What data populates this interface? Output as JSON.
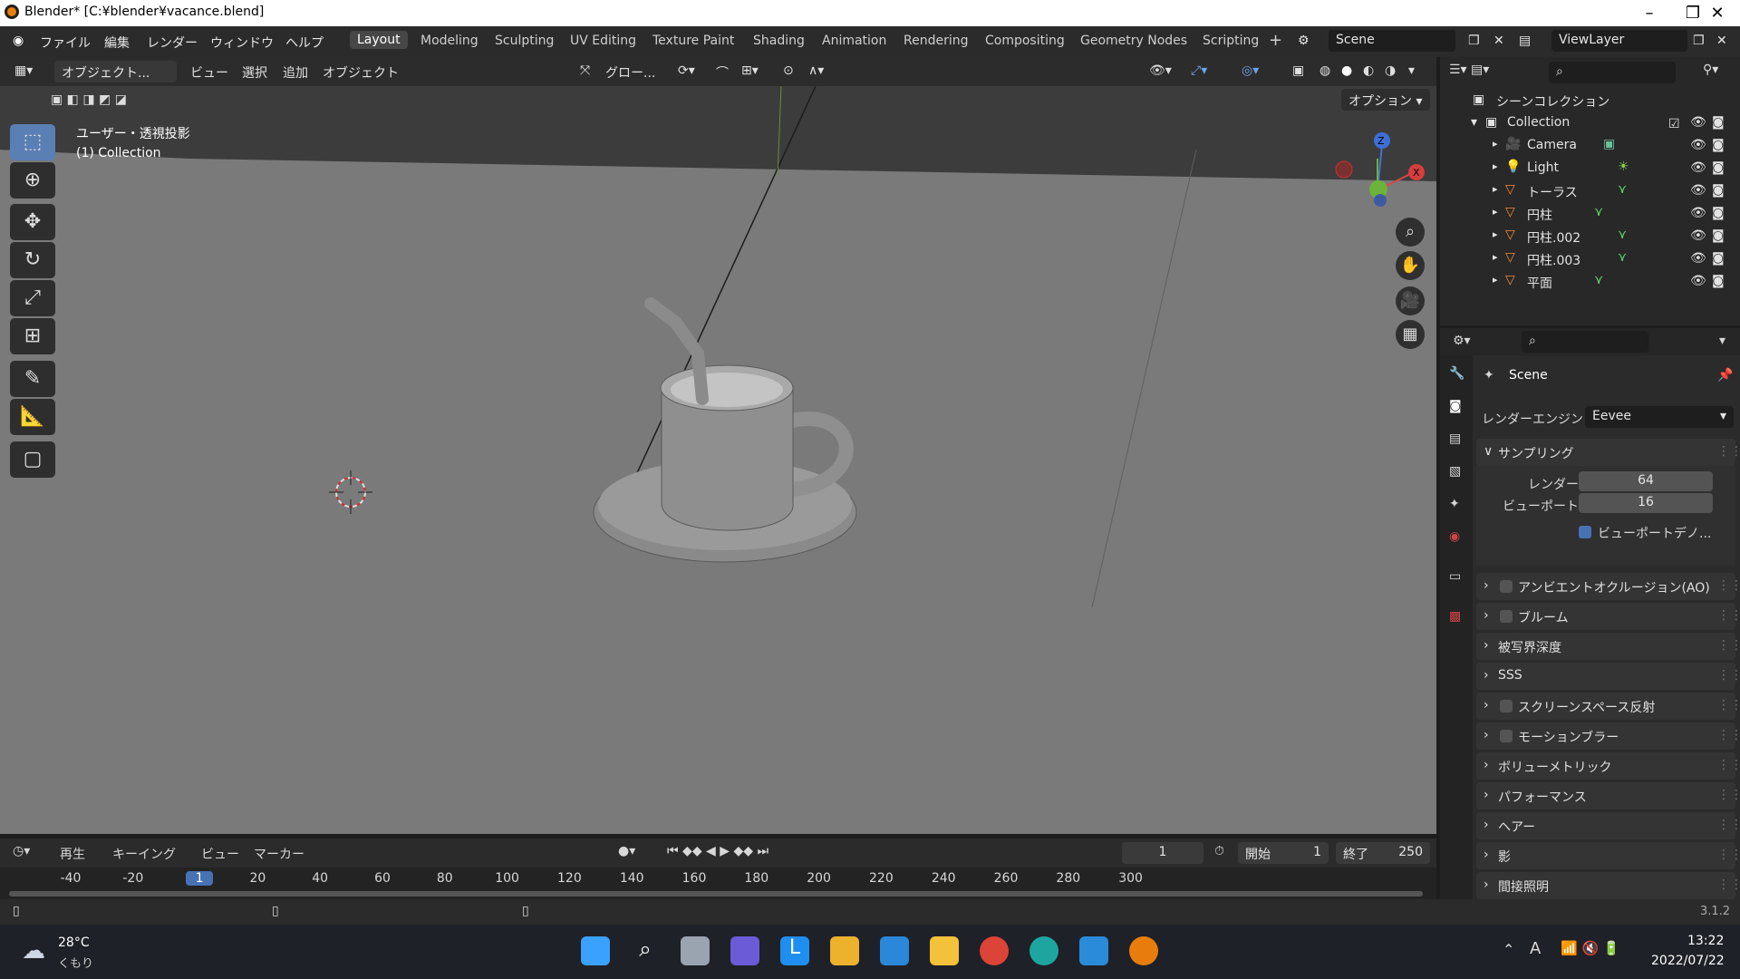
{
  "window": {
    "title": "Blender* [C:¥blender¥vacance.blend]"
  },
  "menubar": {
    "items": [
      "ファイル",
      "編集",
      "レンダー",
      "ウィンドウ",
      "ヘルプ"
    ],
    "workspaces": [
      "Layout",
      "Modeling",
      "Sculpting",
      "UV Editing",
      "Texture Paint",
      "Shading",
      "Animation",
      "Rendering",
      "Compositing",
      "Geometry Nodes",
      "Scripting"
    ],
    "active_workspace": "Layout",
    "scene": "Scene",
    "view_layer": "ViewLayer"
  },
  "viewport_header": {
    "mode": "オブジェクト...",
    "menus": [
      "ビュー",
      "選択",
      "追加",
      "オブジェクト"
    ],
    "transform": "グロー...",
    "options": "オプション"
  },
  "viewport": {
    "view_name": "ユーザー・透視投影",
    "collection": "(1) Collection"
  },
  "outliner": {
    "root": "シーンコレクション",
    "collection": "Collection",
    "objects": [
      "Camera",
      "Light",
      "トーラス",
      "円柱",
      "円柱.002",
      "円柱.003",
      "平面"
    ]
  },
  "properties": {
    "scene_label": "Scene",
    "engine_label": "レンダーエンジン",
    "engine_value": "Eevee",
    "sampling_label": "サンプリング",
    "render_label": "レンダー",
    "render_value": "64",
    "viewport_label": "ビューポート",
    "viewport_value": "16",
    "denoise_label": "ビューポートデノ...",
    "panels": [
      "アンビエントオクルージョン(AO)",
      "ブルーム",
      "被写界深度",
      "SSS",
      "スクリーンスペース反射",
      "モーションブラー",
      "ボリューメトリック",
      "パフォーマンス",
      "ヘアー",
      "影",
      "間接照明"
    ]
  },
  "timeline": {
    "menus": [
      "再生",
      "キーイング",
      "ビュー",
      "マーカー"
    ],
    "current_frame": "1",
    "start_label": "開始",
    "start_value": "1",
    "end_label": "終了",
    "end_value": "250",
    "ticks": [
      "-40",
      "-20",
      "1",
      "20",
      "40",
      "60",
      "80",
      "100",
      "120",
      "140",
      "160",
      "180",
      "200",
      "220",
      "240",
      "260",
      "280",
      "300"
    ]
  },
  "status": {
    "version": "3.1.2"
  },
  "taskbar": {
    "temp": "28°C",
    "weather": "くもり",
    "ime": "A",
    "time": "13:22",
    "date": "2022/07/22"
  }
}
